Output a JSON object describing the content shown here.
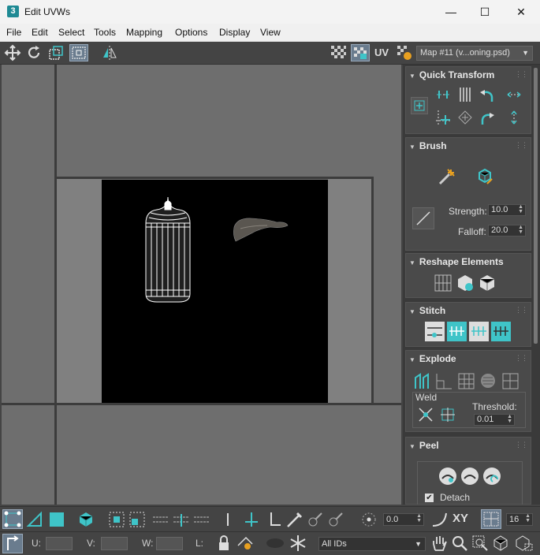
{
  "window": {
    "title": "Edit UVWs",
    "logo": "3",
    "minimize": "—",
    "maximize": "☐",
    "close": "✕"
  },
  "menu": [
    "File",
    "Edit",
    "Select",
    "Tools",
    "Mapping",
    "Options",
    "Display",
    "View"
  ],
  "toolbar": {
    "uv_label": "UV",
    "map_select": "Map #11 (v...oning.psd)",
    "icons": [
      "move-icon",
      "rotate-icon",
      "scale-icon",
      "freeform-icon",
      "mirror-icon",
      "checker-icon",
      "checker-active-icon",
      "uv-axis-icon",
      "map-icon"
    ]
  },
  "quick_transform": {
    "title": "Quick Transform"
  },
  "brush": {
    "title": "Brush",
    "strength_label": "Strength:",
    "strength_value": "10.0",
    "falloff_label": "Falloff:",
    "falloff_value": "20.0"
  },
  "reshape": {
    "title": "Reshape Elements"
  },
  "stitch": {
    "title": "Stitch"
  },
  "explode": {
    "title": "Explode",
    "weld_label": "Weld",
    "threshold_label": "Threshold:",
    "threshold_value": "0.01"
  },
  "peel": {
    "title": "Peel",
    "detach_label": "Detach",
    "detach_checked": true
  },
  "bottom": {
    "rotation_value": "0.0",
    "xy_label": "XY",
    "grid_value": "16",
    "u_label": "U:",
    "v_label": "V:",
    "w_label": "W:",
    "l_label": "L:",
    "ids_select": "All IDs"
  },
  "colors": {
    "accent": "#3fc4c8",
    "panel": "#4a4a4a",
    "viewport": "#6e6e6e",
    "uv_tile": "#000000"
  }
}
